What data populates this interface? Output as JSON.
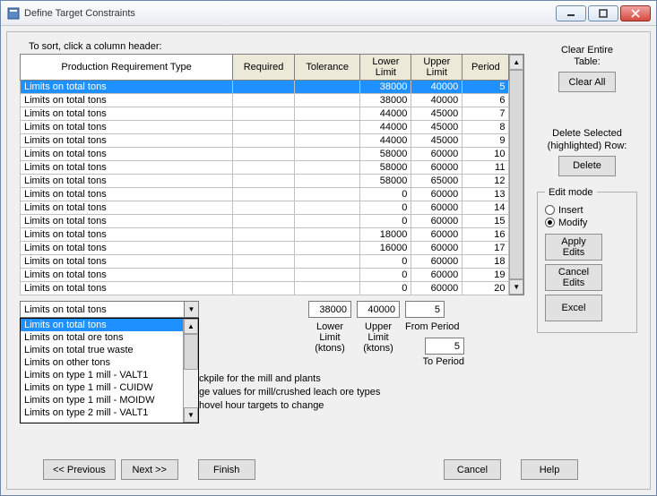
{
  "window": {
    "title": "Define Target Constraints"
  },
  "sort_instruction": "To sort, click a column header:",
  "columns": {
    "prod_type": "Production Requirement Type",
    "required": "Required",
    "tolerance": "Tolerance",
    "lower_limit": "Lower\nLimit",
    "upper_limit": "Upper\nLimit",
    "period": "Period"
  },
  "rows": [
    {
      "type": "Limits on total tons",
      "required": "",
      "tolerance": "",
      "lower": "38000",
      "upper": "40000",
      "period": "5",
      "sel": true
    },
    {
      "type": "Limits on total tons",
      "required": "",
      "tolerance": "",
      "lower": "38000",
      "upper": "40000",
      "period": "6"
    },
    {
      "type": "Limits on total tons",
      "required": "",
      "tolerance": "",
      "lower": "44000",
      "upper": "45000",
      "period": "7"
    },
    {
      "type": "Limits on total tons",
      "required": "",
      "tolerance": "",
      "lower": "44000",
      "upper": "45000",
      "period": "8"
    },
    {
      "type": "Limits on total tons",
      "required": "",
      "tolerance": "",
      "lower": "44000",
      "upper": "45000",
      "period": "9"
    },
    {
      "type": "Limits on total tons",
      "required": "",
      "tolerance": "",
      "lower": "58000",
      "upper": "60000",
      "period": "10"
    },
    {
      "type": "Limits on total tons",
      "required": "",
      "tolerance": "",
      "lower": "58000",
      "upper": "60000",
      "period": "11"
    },
    {
      "type": "Limits on total tons",
      "required": "",
      "tolerance": "",
      "lower": "58000",
      "upper": "65000",
      "period": "12"
    },
    {
      "type": "Limits on total tons",
      "required": "",
      "tolerance": "",
      "lower": "0",
      "upper": "60000",
      "period": "13"
    },
    {
      "type": "Limits on total tons",
      "required": "",
      "tolerance": "",
      "lower": "0",
      "upper": "60000",
      "period": "14"
    },
    {
      "type": "Limits on total tons",
      "required": "",
      "tolerance": "",
      "lower": "0",
      "upper": "60000",
      "period": "15"
    },
    {
      "type": "Limits on total tons",
      "required": "",
      "tolerance": "",
      "lower": "18000",
      "upper": "60000",
      "period": "16"
    },
    {
      "type": "Limits on total tons",
      "required": "",
      "tolerance": "",
      "lower": "16000",
      "upper": "60000",
      "period": "17"
    },
    {
      "type": "Limits on total tons",
      "required": "",
      "tolerance": "",
      "lower": "0",
      "upper": "60000",
      "period": "18"
    },
    {
      "type": "Limits on total tons",
      "required": "",
      "tolerance": "",
      "lower": "0",
      "upper": "60000",
      "period": "19"
    },
    {
      "type": "Limits on total tons",
      "required": "",
      "tolerance": "",
      "lower": "0",
      "upper": "60000",
      "period": "20"
    }
  ],
  "side": {
    "clear_label": "Clear Entire\nTable:",
    "clear_all": "Clear All",
    "delete_label": "Delete Selected\n(highlighted) Row:",
    "delete": "Delete",
    "edit_mode": "Edit mode",
    "insert": "Insert",
    "modify": "Modify",
    "apply_edits": "Apply\nEdits",
    "cancel_edits": "Cancel\nEdits",
    "excel": "Excel"
  },
  "edit_inputs": {
    "lower": "38000",
    "upper": "40000",
    "from_period": "5",
    "to_period": "5",
    "lower_label": "Lower\nLimit\n(ktons)",
    "upper_label": "Upper\nLimit\n(ktons)",
    "from_label": "From Period",
    "to_label": "To Period"
  },
  "combo": {
    "value": "Limits on total tons",
    "options": [
      "Limits on total tons",
      "Limits on total ore tons",
      "Limits on total true waste",
      "Limits on other tons",
      "Limits on type 1 mill - VALT1",
      "Limits on type 1 mill - CUIDW",
      "Limits on type 1 mill - MOIDW",
      "Limits on type 2 mill - VALT1"
    ]
  },
  "help_lines": {
    "l1": "ckpile for the mill and plants",
    "l2": "ge values for mill/crushed leach ore types",
    "l3": "hovel hour targets to change"
  },
  "buttons": {
    "previous": "<< Previous",
    "next": "Next >>",
    "finish": "Finish",
    "cancel": "Cancel",
    "help": "Help"
  }
}
